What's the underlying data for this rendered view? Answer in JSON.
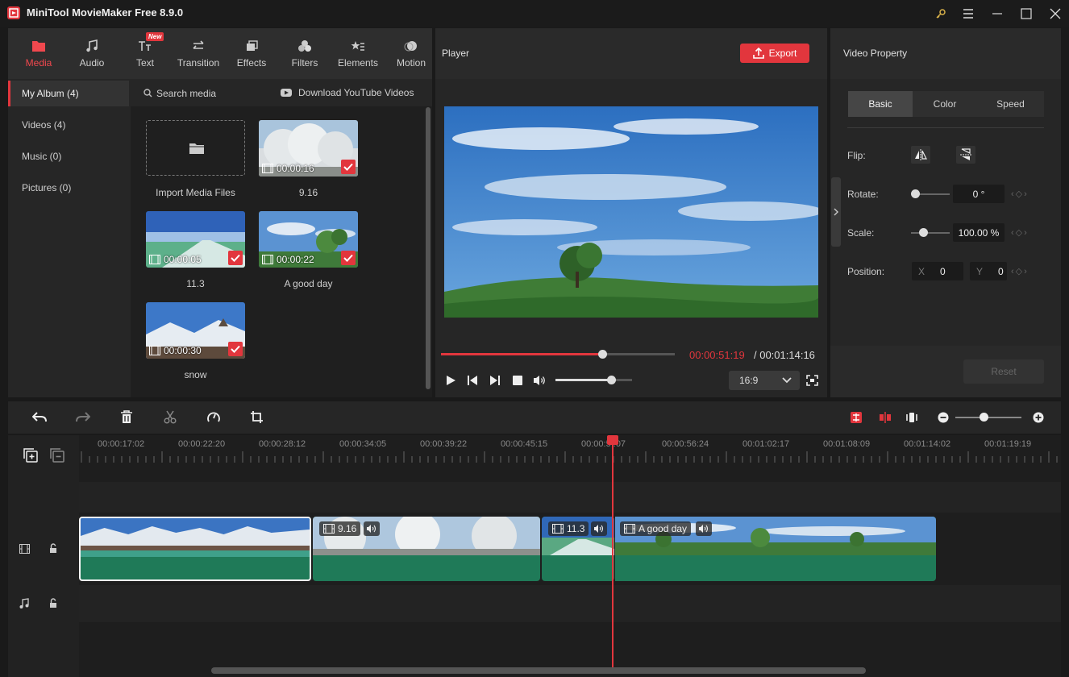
{
  "app": {
    "title": "MiniTool MovieMaker Free 8.9.0"
  },
  "media_tabs": [
    {
      "label": "Media",
      "icon": "folder-icon",
      "active": true
    },
    {
      "label": "Audio",
      "icon": "music-note-icon"
    },
    {
      "label": "Text",
      "icon": "text-icon",
      "badge": "New"
    },
    {
      "label": "Transition",
      "icon": "transition-arrows-icon"
    },
    {
      "label": "Effects",
      "icon": "effects-icon"
    },
    {
      "label": "Filters",
      "icon": "filters-icon"
    },
    {
      "label": "Elements",
      "icon": "elements-icon"
    },
    {
      "label": "Motion",
      "icon": "motion-icon"
    }
  ],
  "albums": [
    {
      "label": "My Album (4)",
      "active": true
    },
    {
      "label": "Videos (4)"
    },
    {
      "label": "Music (0)"
    },
    {
      "label": "Pictures (0)"
    }
  ],
  "media_header": {
    "search": "Search media",
    "youtube": "Download YouTube Videos"
  },
  "media_items": [
    {
      "caption": "Import Media Files"
    },
    {
      "caption": "9.16",
      "duration": "00:00:16"
    },
    {
      "caption": "11.3",
      "duration": "00:00:05"
    },
    {
      "caption": "A good day",
      "duration": "00:00:22"
    },
    {
      "caption": "snow",
      "duration": "00:00:30"
    }
  ],
  "player": {
    "title": "Player",
    "export_label": "Export",
    "current_time": "00:00:51:19",
    "total_time": "/ 00:01:14:16",
    "progress": 0.69,
    "volume": 0.73,
    "aspect": "16:9"
  },
  "property": {
    "title": "Video Property",
    "tabs": [
      "Basic",
      "Color",
      "Speed"
    ],
    "flip_label": "Flip:",
    "rotate_label": "Rotate:",
    "rotate_value": "0 °",
    "scale_label": "Scale:",
    "scale_value": "100.00 %",
    "position_label": "Position:",
    "pos_x_label": "X",
    "pos_x": "0",
    "pos_y_label": "Y",
    "pos_y": "0",
    "reset_label": "Reset"
  },
  "timeline": {
    "ticks": [
      "00:00:17:02",
      "00:00:22:20",
      "00:00:28:12",
      "00:00:34:05",
      "00:00:39:22",
      "00:00:45:15",
      "00:00:5 :07",
      "00:00:56:24",
      "00:01:02:17",
      "00:01:08:09",
      "00:01:14:02",
      "00:01:19:19"
    ],
    "clips": [
      {
        "name": "",
        "type": "snow"
      },
      {
        "name": "9.16",
        "type": "tree"
      },
      {
        "name": "11.3",
        "type": "road"
      },
      {
        "name": "A good day",
        "type": "landscape"
      }
    ]
  },
  "colors": {
    "accent": "#e2363d",
    "clip_green": "#1f7a58"
  }
}
